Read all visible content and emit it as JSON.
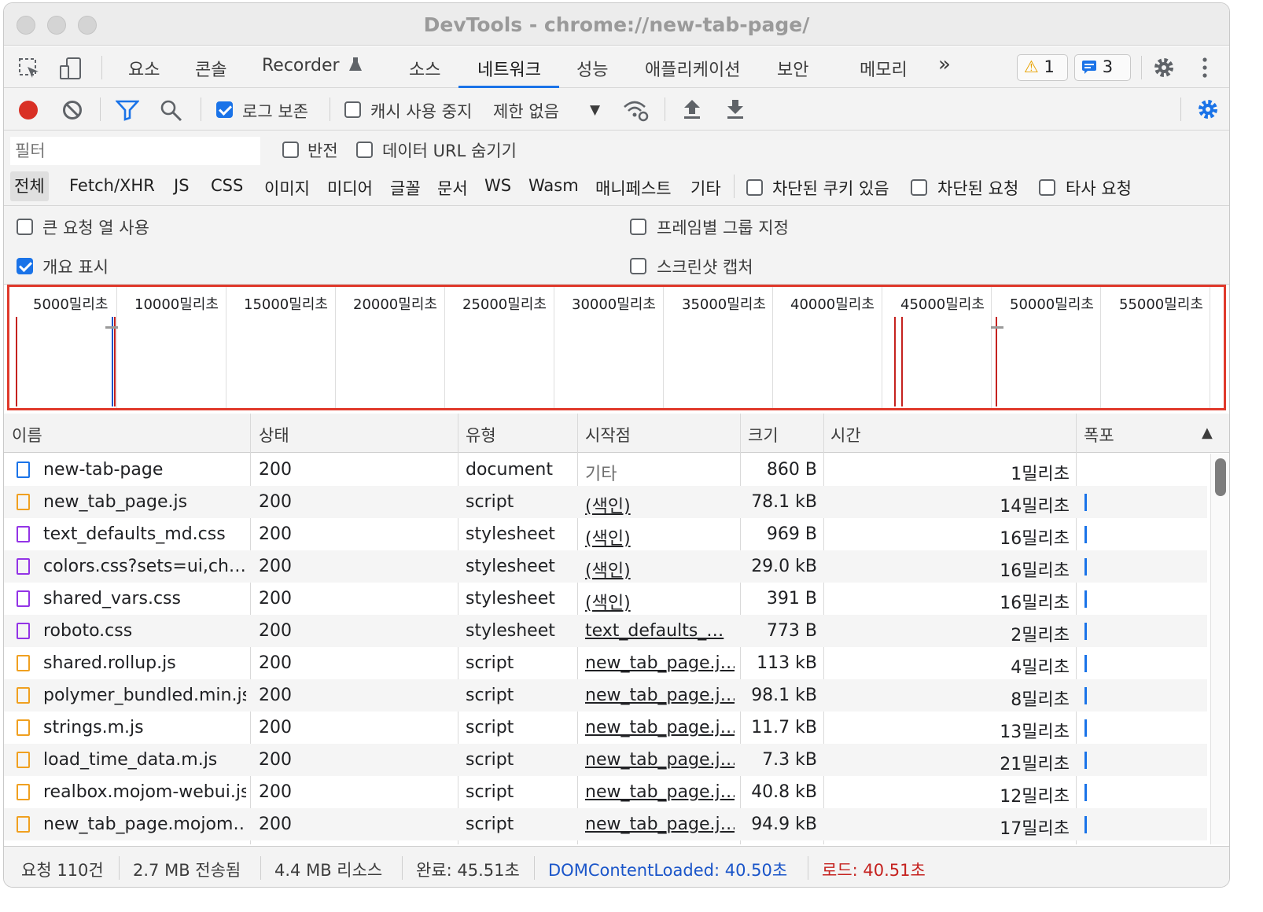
{
  "window": {
    "title": "DevTools - chrome://new-tab-page/"
  },
  "tabs": {
    "items": [
      "요소",
      "콘솔",
      "Recorder",
      "소스",
      "네트워크",
      "성능",
      "애플리케이션",
      "보안",
      "메모리"
    ],
    "more": "»",
    "warnings": "1",
    "messages": "3"
  },
  "toolbar": {
    "preserve_log": "로그 보존",
    "disable_cache": "캐시 사용 중지",
    "throttling": "제한 없음"
  },
  "filter": {
    "placeholder": "필터",
    "invert": "반전",
    "hide_data_urls": "데이터 URL 숨기기",
    "types": [
      "전체",
      "Fetch/XHR",
      "JS",
      "CSS",
      "이미지",
      "미디어",
      "글꼴",
      "문서",
      "WS",
      "Wasm",
      "매니페스트",
      "기타"
    ],
    "blocked_cookies": "차단된 쿠키 있음",
    "blocked_requests": "차단된 요청",
    "third_party": "타사 요청"
  },
  "options": {
    "big_rows": "큰 요청 열 사용",
    "group_by_frame": "프레임별 그룹 지정",
    "show_overview": "개요 표시",
    "capture_screenshots": "스크린샷 캡처"
  },
  "overview": {
    "ticks": [
      "5000밀리초",
      "10000밀리초",
      "15000밀리초",
      "20000밀리초",
      "25000밀리초",
      "30000밀리초",
      "35000밀리초",
      "40000밀리초",
      "45000밀리초",
      "50000밀리초",
      "55000밀리초"
    ]
  },
  "table": {
    "headers": {
      "name": "이름",
      "status": "상태",
      "type": "유형",
      "initiator": "시작점",
      "size": "크기",
      "time": "시간",
      "waterfall": "폭포",
      "sort_icon": "▲"
    },
    "rows": [
      {
        "name": "new-tab-page",
        "icon": "document",
        "status": "200",
        "type": "document",
        "initiator": "기타",
        "size": "860 B",
        "time": "1밀리초"
      },
      {
        "name": "new_tab_page.js",
        "icon": "script",
        "status": "200",
        "type": "script",
        "initiator": "(색인)",
        "size": "78.1 kB",
        "time": "14밀리초"
      },
      {
        "name": "text_defaults_md.css",
        "icon": "stylesheet",
        "status": "200",
        "type": "stylesheet",
        "initiator": "(색인)",
        "size": "969 B",
        "time": "16밀리초"
      },
      {
        "name": "colors.css?sets=ui,ch…",
        "icon": "stylesheet",
        "status": "200",
        "type": "stylesheet",
        "initiator": "(색인)",
        "size": "29.0 kB",
        "time": "16밀리초"
      },
      {
        "name": "shared_vars.css",
        "icon": "stylesheet",
        "status": "200",
        "type": "stylesheet",
        "initiator": "(색인)",
        "size": "391 B",
        "time": "16밀리초"
      },
      {
        "name": "roboto.css",
        "icon": "stylesheet",
        "status": "200",
        "type": "stylesheet",
        "initiator": "text_defaults_…",
        "size": "773 B",
        "time": "2밀리초"
      },
      {
        "name": "shared.rollup.js",
        "icon": "script",
        "status": "200",
        "type": "script",
        "initiator": "new_tab_page.j…",
        "size": "113 kB",
        "time": "4밀리초"
      },
      {
        "name": "polymer_bundled.min.js",
        "icon": "script",
        "status": "200",
        "type": "script",
        "initiator": "new_tab_page.j…",
        "size": "98.1 kB",
        "time": "8밀리초"
      },
      {
        "name": "strings.m.js",
        "icon": "script",
        "status": "200",
        "type": "script",
        "initiator": "new_tab_page.j…",
        "size": "11.7 kB",
        "time": "13밀리초"
      },
      {
        "name": "load_time_data.m.js",
        "icon": "script",
        "status": "200",
        "type": "script",
        "initiator": "new_tab_page.j…",
        "size": "7.3 kB",
        "time": "21밀리초"
      },
      {
        "name": "realbox.mojom-webui.js",
        "icon": "script",
        "status": "200",
        "type": "script",
        "initiator": "new_tab_page.j…",
        "size": "40.8 kB",
        "time": "12밀리초"
      },
      {
        "name": "new_tab_page.mojom…",
        "icon": "script",
        "status": "200",
        "type": "script",
        "initiator": "new_tab_page.j…",
        "size": "94.9 kB",
        "time": "17밀리초"
      }
    ]
  },
  "status": {
    "requests": "요청 110건",
    "transferred": "2.7 MB 전송됨",
    "resources": "4.4 MB 리소스",
    "finish": "완료: 45.51초",
    "dcl": "DOMContentLoaded: 40.50초",
    "load": "로드: 40.51초"
  },
  "colors": {
    "accent": "#1a73e8",
    "record": "#d93025",
    "highlight_border": "#e0392b"
  }
}
